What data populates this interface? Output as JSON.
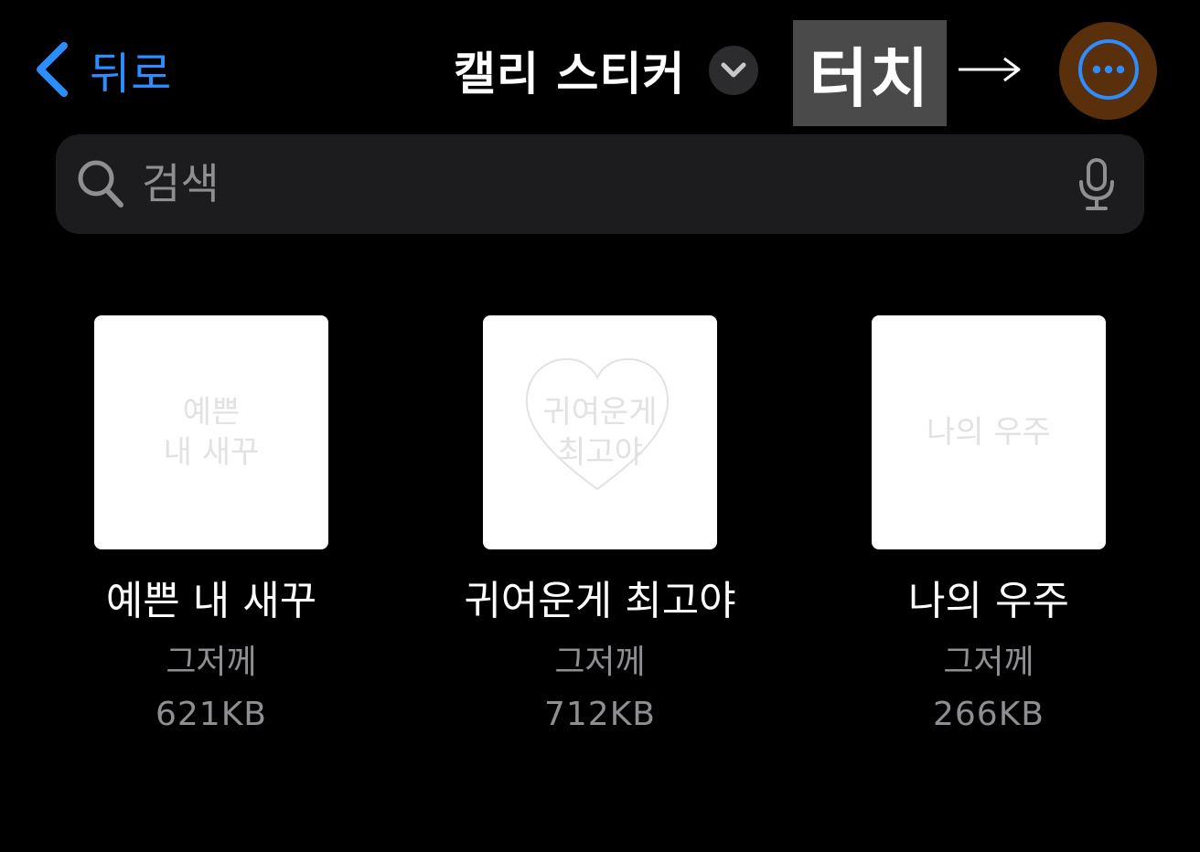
{
  "header": {
    "back_label": "뒤로",
    "title": "캘리 스티커",
    "annotation_label": "터치",
    "annotation_arrow": "→"
  },
  "search": {
    "placeholder": "검색",
    "value": ""
  },
  "files": [
    {
      "name": "예쁜 내 새꾸",
      "date": "그저께",
      "size": "621KB",
      "art_lines": [
        "예쁜",
        "내 새꾸"
      ]
    },
    {
      "name": "귀여운게 최고야",
      "date": "그저께",
      "size": "712KB",
      "art_lines": [
        "귀여운게",
        "최고야"
      ]
    },
    {
      "name": "나의 우주",
      "date": "그저께",
      "size": "266KB",
      "art_lines": [
        "나의 우주"
      ]
    }
  ],
  "colors": {
    "accent_blue": "#2d8cff",
    "more_button_bg": "#5a2f0c",
    "more_button_ring": "#2d8cff",
    "annotation_bg": "#4a4a4a"
  },
  "icons": {
    "back": "chevron-left-icon",
    "title_menu": "chevron-down-icon",
    "more": "ellipsis-circle-icon",
    "search": "magnifying-glass-icon",
    "mic": "microphone-icon"
  }
}
